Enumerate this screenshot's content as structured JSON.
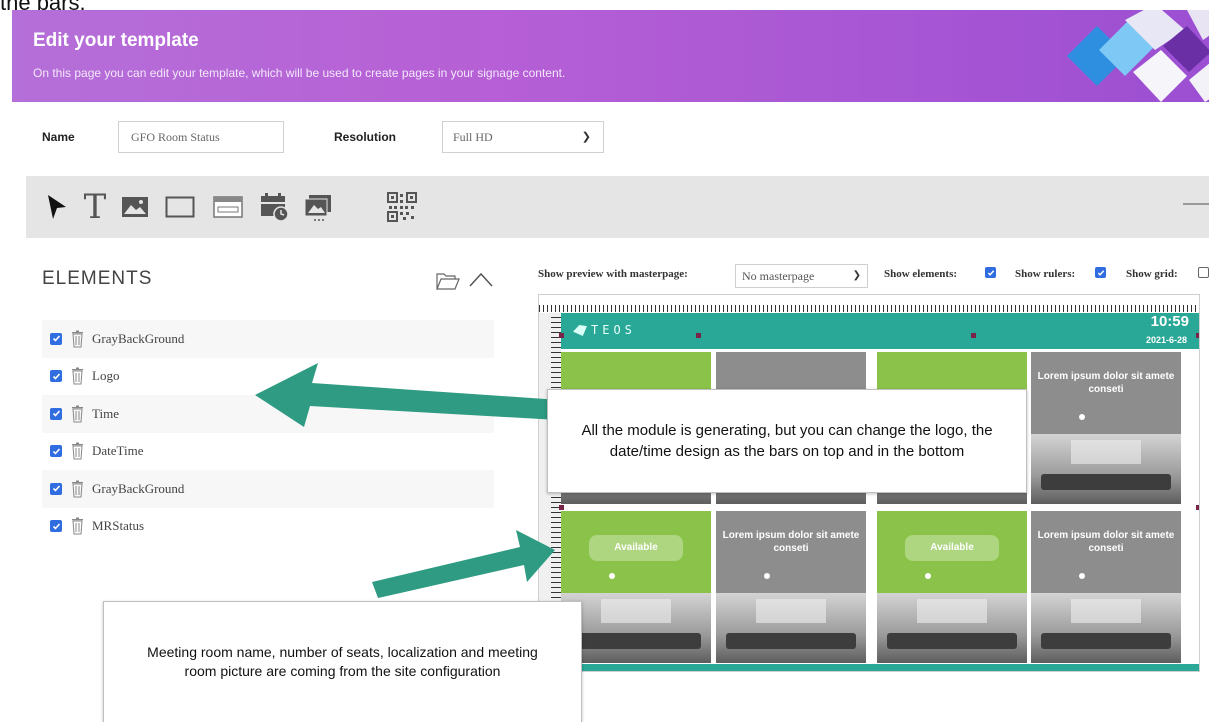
{
  "caption_top": "the bars.",
  "header": {
    "title": "Edit your template",
    "subtitle": "On this page you can edit your template, which will be used to create pages in your signage content."
  },
  "form": {
    "name_label": "Name",
    "name_value": "GFO Room Status",
    "resolution_label": "Resolution",
    "resolution_value": "Full HD"
  },
  "toolbar": {
    "tools": [
      "pointer-icon",
      "text-icon",
      "image-icon",
      "rectangle-icon",
      "web-icon",
      "calendar-clock-icon",
      "slideshow-icon",
      "qr-code-icon"
    ],
    "text_tool_glyph": "T"
  },
  "elements": {
    "title": "ELEMENTS",
    "items": [
      {
        "label": "GrayBackGround",
        "checked": true
      },
      {
        "label": "Logo",
        "checked": true
      },
      {
        "label": "Time",
        "checked": true
      },
      {
        "label": "DateTime",
        "checked": true
      },
      {
        "label": "GrayBackGround",
        "checked": true
      },
      {
        "label": "MRStatus",
        "checked": true
      }
    ]
  },
  "options": {
    "preview_label": "Show preview with masterpage:",
    "masterpage_value": "No masterpage",
    "show_elements_label": "Show elements:",
    "show_elements": true,
    "show_rulers_label": "Show rulers:",
    "show_rulers": true,
    "show_grid_label": "Show grid:",
    "show_grid": false
  },
  "preview": {
    "brand": "TEOS",
    "time": "10:59",
    "date": "2021-6-28",
    "available_label": "Available",
    "lorem_text": "Lorem ipsum dolor sit amete conseti",
    "colors": {
      "green": "#8bc34a",
      "gray": "#8d8d8d",
      "teal": "#2aa897"
    }
  },
  "callouts": {
    "top": "All the module is generating, but you can change the logo, the date/time design as the bars on top and in the bottom",
    "bottom": "Meeting room name, number of seats, localization and meeting room picture are coming from the site configuration"
  }
}
